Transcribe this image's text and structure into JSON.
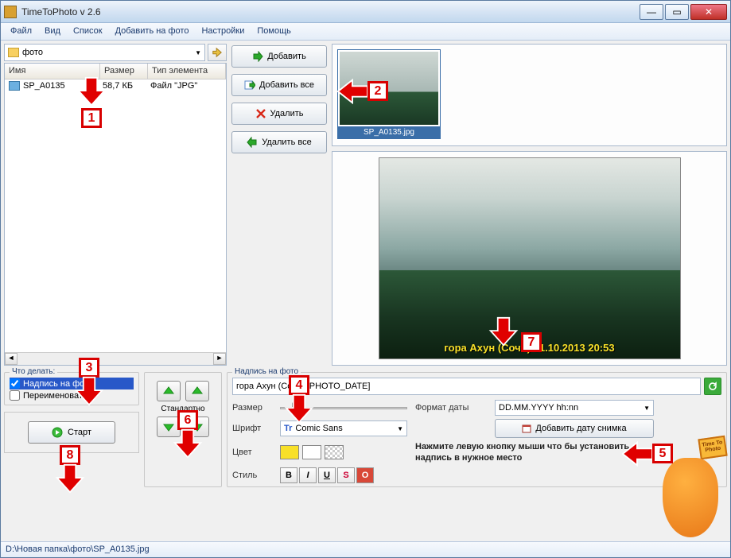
{
  "title": "TimeToPhoto v 2.6",
  "menu": [
    "Файл",
    "Вид",
    "Список",
    "Добавить на фото",
    "Настройки",
    "Помощь"
  ],
  "path": {
    "label": "фото"
  },
  "file_list": {
    "headers": [
      "Имя",
      "Размер",
      "Тип элемента"
    ],
    "rows": [
      {
        "name": "SP_A0135",
        "size": "58,7 КБ",
        "type": "Файл \"JPG\""
      }
    ]
  },
  "buttons": {
    "add": "Добавить",
    "add_all": "Добавить все",
    "remove": "Удалить",
    "remove_all": "Удалить все",
    "start": "Старт",
    "default": "Стандартно",
    "add_date": "Добавить дату снимка"
  },
  "thumb": {
    "caption": "SP_A0135.jpg"
  },
  "preview": {
    "caption": "гора Ахун (Сочи) 01.10.2013 20:53"
  },
  "whatdo": {
    "legend": "Что делать:",
    "opt1": "Надпись на фото",
    "opt2": "Переименовать"
  },
  "caption_panel": {
    "legend": "Надпись на фото",
    "text_value": "гора Ахун (Сочи) [PHOTO_DATE]",
    "size_lbl": "Размер",
    "font_lbl": "Шрифт",
    "font_value": "Comic Sans",
    "color_lbl": "Цвет",
    "style_lbl": "Стиль",
    "dateformat_lbl": "Формат даты",
    "dateformat_value": "DD.MM.YYYY hh:nn",
    "hint": "Нажмите левую кнопку мыши что бы установить надпись в нужное место"
  },
  "statusbar": "D:\\Новая папка\\фото\\SP_A0135.jpg",
  "annotations": [
    "1",
    "2",
    "3",
    "4",
    "5",
    "6",
    "7",
    "8"
  ],
  "mascot_sign": "Time To Photo"
}
